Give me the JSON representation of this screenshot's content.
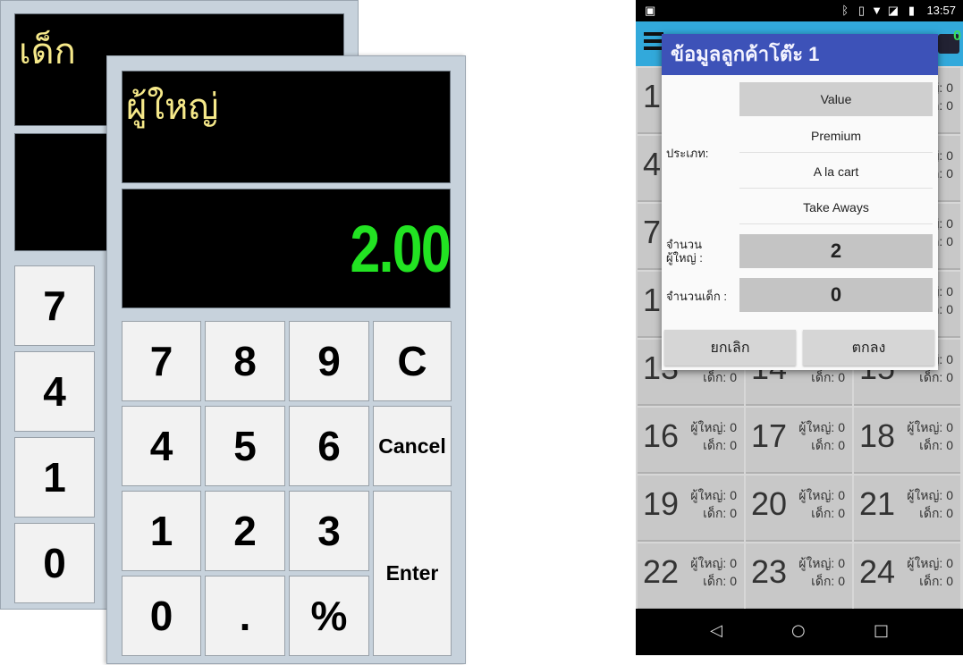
{
  "child_keypad": {
    "title": "เด็ก",
    "keys": [
      "7",
      "4",
      "1",
      "0"
    ]
  },
  "adult_keypad": {
    "title": "ผู้ใหญ่",
    "display_value": "2.00",
    "keys": {
      "k7": "7",
      "k8": "8",
      "k9": "9",
      "clear": "C",
      "k4": "4",
      "k5": "5",
      "k6": "6",
      "cancel": "Cancel",
      "k1": "1",
      "k2": "2",
      "k3": "3",
      "enter": "Enter",
      "k0": "0",
      "dot": ".",
      "percent": "%"
    },
    "colors": {
      "display_text": "#22e322",
      "title_text": "#f6e98a",
      "display_bg": "#000000"
    }
  },
  "phone": {
    "status_bar": {
      "time": "13:57",
      "icons": [
        "image-icon",
        "bluetooth-icon",
        "vibrate-icon",
        "wifi-icon",
        "no-sim-icon",
        "battery-icon"
      ]
    },
    "app_bar": {
      "cart_count": "0"
    },
    "tile_labels": {
      "adult": "ผู้ใหญ่: 0",
      "child": "เด็ก: 0"
    },
    "tiles": [
      {
        "num": "1"
      },
      {
        "num": ""
      },
      {
        "num": ""
      },
      {
        "num": "4"
      },
      {
        "num": ""
      },
      {
        "num": ""
      },
      {
        "num": "7"
      },
      {
        "num": ""
      },
      {
        "num": ""
      },
      {
        "num": "1"
      },
      {
        "num": ""
      },
      {
        "num": ""
      },
      {
        "num": "13"
      },
      {
        "num": "14"
      },
      {
        "num": "15"
      },
      {
        "num": "16"
      },
      {
        "num": "17"
      },
      {
        "num": "18"
      },
      {
        "num": "19"
      },
      {
        "num": "20"
      },
      {
        "num": "21"
      },
      {
        "num": "22"
      },
      {
        "num": "23"
      },
      {
        "num": "24"
      }
    ],
    "right_edge_values": [
      "0",
      "0"
    ],
    "nav": {
      "back": "◁",
      "home": "○",
      "recents": "□"
    }
  },
  "dialog": {
    "title": "ข้อมูลลูกค้าโต๊ะ 1",
    "type_label": "ประเภท:",
    "options": [
      "Value",
      "Premium",
      "A la cart",
      "Take Aways"
    ],
    "selected_option": "Value",
    "adult_label_line1": "จำนวน",
    "adult_label_line2": "ผู้ใหญ่ :",
    "adult_value": "2",
    "child_label": "จำนวนเด็ก :",
    "child_value": "0",
    "cancel_label": "ยกเลิก",
    "ok_label": "ตกลง"
  }
}
